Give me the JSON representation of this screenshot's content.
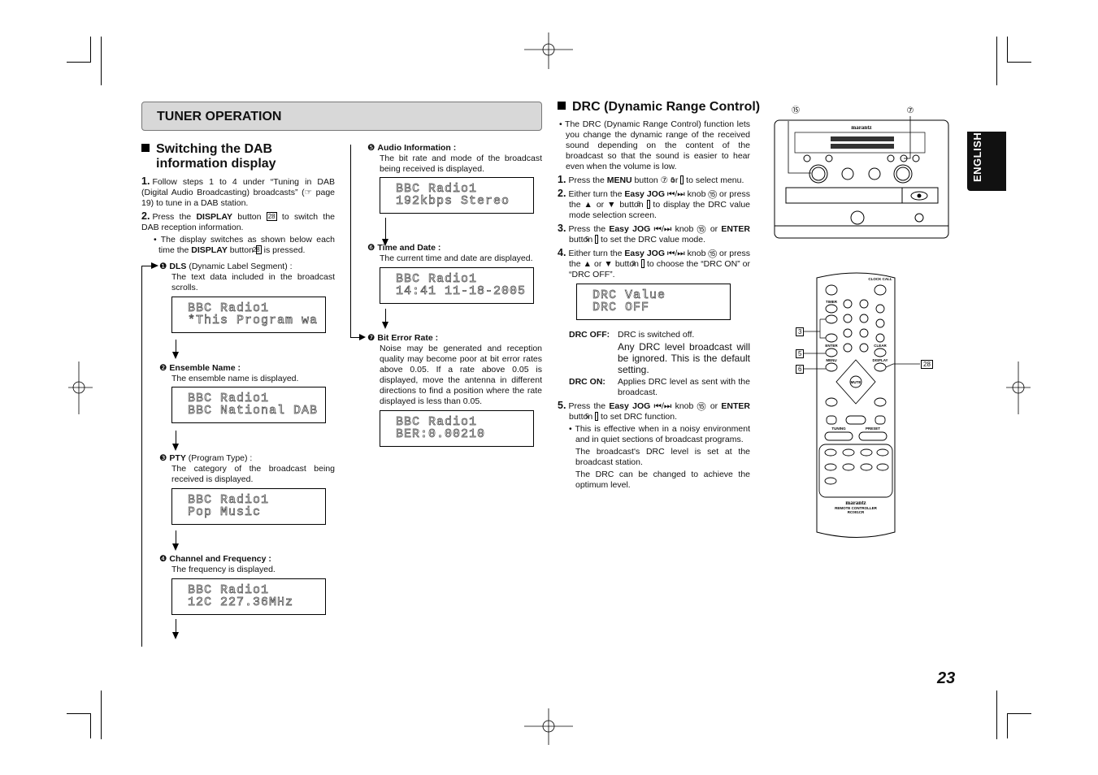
{
  "header": {
    "title": "TUNER OPERATION"
  },
  "language_tab": "ENGLISH",
  "page_number": "23",
  "left": {
    "heading_line1": "Switching the DAB",
    "heading_line2": "information display",
    "step1": {
      "num": "1.",
      "segments": [
        [
          "Follow steps 1 to 4 under “Tuning in DAB (Digital Audio Broadcasting) broadcasts” (☞ page 19) to tune in a DAB station.",
          ""
        ]
      ]
    },
    "step2": {
      "num": "2.",
      "segments": [
        [
          "Press the ",
          ""
        ],
        [
          "DISPLAY",
          "b"
        ],
        [
          " button ",
          ""
        ],
        [
          "28",
          "box"
        ],
        [
          " to switch the DAB reception information.",
          ""
        ]
      ]
    },
    "bullet": {
      "segments": [
        [
          "• The display switches as shown below each time the ",
          ""
        ],
        [
          "DISPLAY",
          "b"
        ],
        [
          " button ",
          ""
        ],
        [
          "28",
          "box"
        ],
        [
          " is pressed.",
          ""
        ]
      ]
    }
  },
  "items": [
    {
      "num": "❶",
      "title": [
        [
          "DLS",
          "b"
        ],
        [
          " (Dynamic Label Segment) :",
          ""
        ]
      ],
      "desc": "The text data included in the broadcast scrolls.",
      "display": [
        "BBC Radio1",
        "*This Program wa"
      ]
    },
    {
      "num": "❷",
      "title": [
        [
          "Ensemble Name :",
          "b"
        ]
      ],
      "desc": "The ensemble name is displayed.",
      "display": [
        "BBC Radio1",
        "BBC National DAB"
      ]
    },
    {
      "num": "❸",
      "title": [
        [
          "PTY",
          "b"
        ],
        [
          " (Program Type) :",
          ""
        ]
      ],
      "desc": "The category of the broadcast being received is displayed.",
      "display": [
        "BBC Radio1",
        "Pop Music"
      ]
    },
    {
      "num": "❹",
      "title": [
        [
          "Channel and Frequency :",
          "b"
        ]
      ],
      "desc": "The frequency is displayed.",
      "display": [
        "BBC Radio1",
        "12C 227.36MHz"
      ]
    },
    {
      "num": "❺",
      "title": [
        [
          "Audio Information :",
          "b"
        ]
      ],
      "desc": "The bit rate and mode of the broadcast being received is displayed.",
      "display": [
        "BBC Radio1",
        "192kbps Stereo"
      ]
    },
    {
      "num": "❻",
      "title": [
        [
          "Time and Date :",
          "b"
        ]
      ],
      "desc": "The current time and date are displayed.",
      "display": [
        "BBC Radio1",
        "14:41 11-18-2005"
      ]
    },
    {
      "num": "❼",
      "title": [
        [
          "Bit Error Rate :",
          "b"
        ]
      ],
      "desc": "Noise may be generated and reception quality may become poor at bit error rates above 0.05. If a rate above 0.05 is displayed, move the antenna in different directions to find a position where the rate displayed is less than 0.05.",
      "display": [
        "BBC Radio1",
        "BER:0.00210"
      ]
    }
  ],
  "drc": {
    "heading": "DRC (Dynamic Range Control)",
    "intro": [
      [
        "• The DRC (Dynamic Range Control) function lets you change the dynamic range of the received sound depending on the content of the broadcast so that the sound is easier to hear even when the volume is low.",
        ""
      ]
    ],
    "step1": {
      "num": "1.",
      "segments": [
        [
          "Press the ",
          ""
        ],
        [
          "MENU",
          "b"
        ],
        [
          " button ⑦ or ",
          ""
        ],
        [
          "6",
          "box"
        ],
        [
          " to select menu.",
          ""
        ]
      ]
    },
    "step2": {
      "num": "2.",
      "segments": [
        [
          "Either turn the ",
          ""
        ],
        [
          "Easy JOG",
          "b"
        ],
        [
          " ⏮/⏭ knob ⑮ or press the ▲ or ▼ button ",
          ""
        ],
        [
          "3",
          "box"
        ],
        [
          " to display the DRC value mode selection screen.",
          ""
        ]
      ]
    },
    "step3": {
      "num": "3.",
      "segments": [
        [
          "Press the ",
          ""
        ],
        [
          "Easy JOG",
          "b"
        ],
        [
          " ⏮/⏭ knob ⑮ or ",
          ""
        ],
        [
          "ENTER",
          "b"
        ],
        [
          " button ",
          ""
        ],
        [
          "5",
          "box"
        ],
        [
          " to set the DRC value mode.",
          ""
        ]
      ]
    },
    "step4": {
      "num": "4.",
      "segments": [
        [
          "Either turn the ",
          ""
        ],
        [
          "Easy JOG",
          "b"
        ],
        [
          " ⏮/⏭ knob ⑮ or press the ▲ or ▼ button ",
          ""
        ],
        [
          "3",
          "box"
        ],
        [
          " to choose the “DRC ON” or “DRC OFF”.",
          ""
        ]
      ]
    },
    "display": [
      "DRC Value",
      "DRC OFF"
    ],
    "off_label": "DRC OFF:",
    "off_text1": "DRC is switched off.",
    "off_text2": "Any DRC level broadcast will be ignored. This is the default setting.",
    "on_label": "DRC ON:",
    "on_text": "Applies DRC level as sent with the broadcast.",
    "step5": {
      "num": "5.",
      "segments": [
        [
          "Press the ",
          ""
        ],
        [
          "Easy JOG",
          "b"
        ],
        [
          " ⏮/⏭ knob ⑮ or ",
          ""
        ],
        [
          "ENTER",
          "b"
        ],
        [
          " button ",
          ""
        ],
        [
          "5",
          "box"
        ],
        [
          " to set DRC function.",
          ""
        ]
      ]
    },
    "note1": "• This is effective when in a noisy environment and in quiet sections of broadcast programs.",
    "note2": "The broadcast's DRC level is set at the broadcast station.",
    "note3": "The DRC can be changed to achieve the optimum level."
  },
  "device": {
    "brand": "marantz",
    "callout_jog": "⑮",
    "callout_menu": "⑦"
  },
  "remote": {
    "brand": "marantz",
    "model_line1": "REMOTE CONTROLLER",
    "model_line2": "RC001CR",
    "clock_call": "CLOCK CALL",
    "timer": "TIMER",
    "enter": "ENTER",
    "clear": "CLEAR",
    "menu": "MENU",
    "display": "DISPLAY",
    "mute": "MUTE",
    "tuning": "TUNING",
    "preset": "PRESET",
    "callout_3": "3",
    "callout_5": "5",
    "callout_6": "6",
    "callout_28": "28"
  }
}
